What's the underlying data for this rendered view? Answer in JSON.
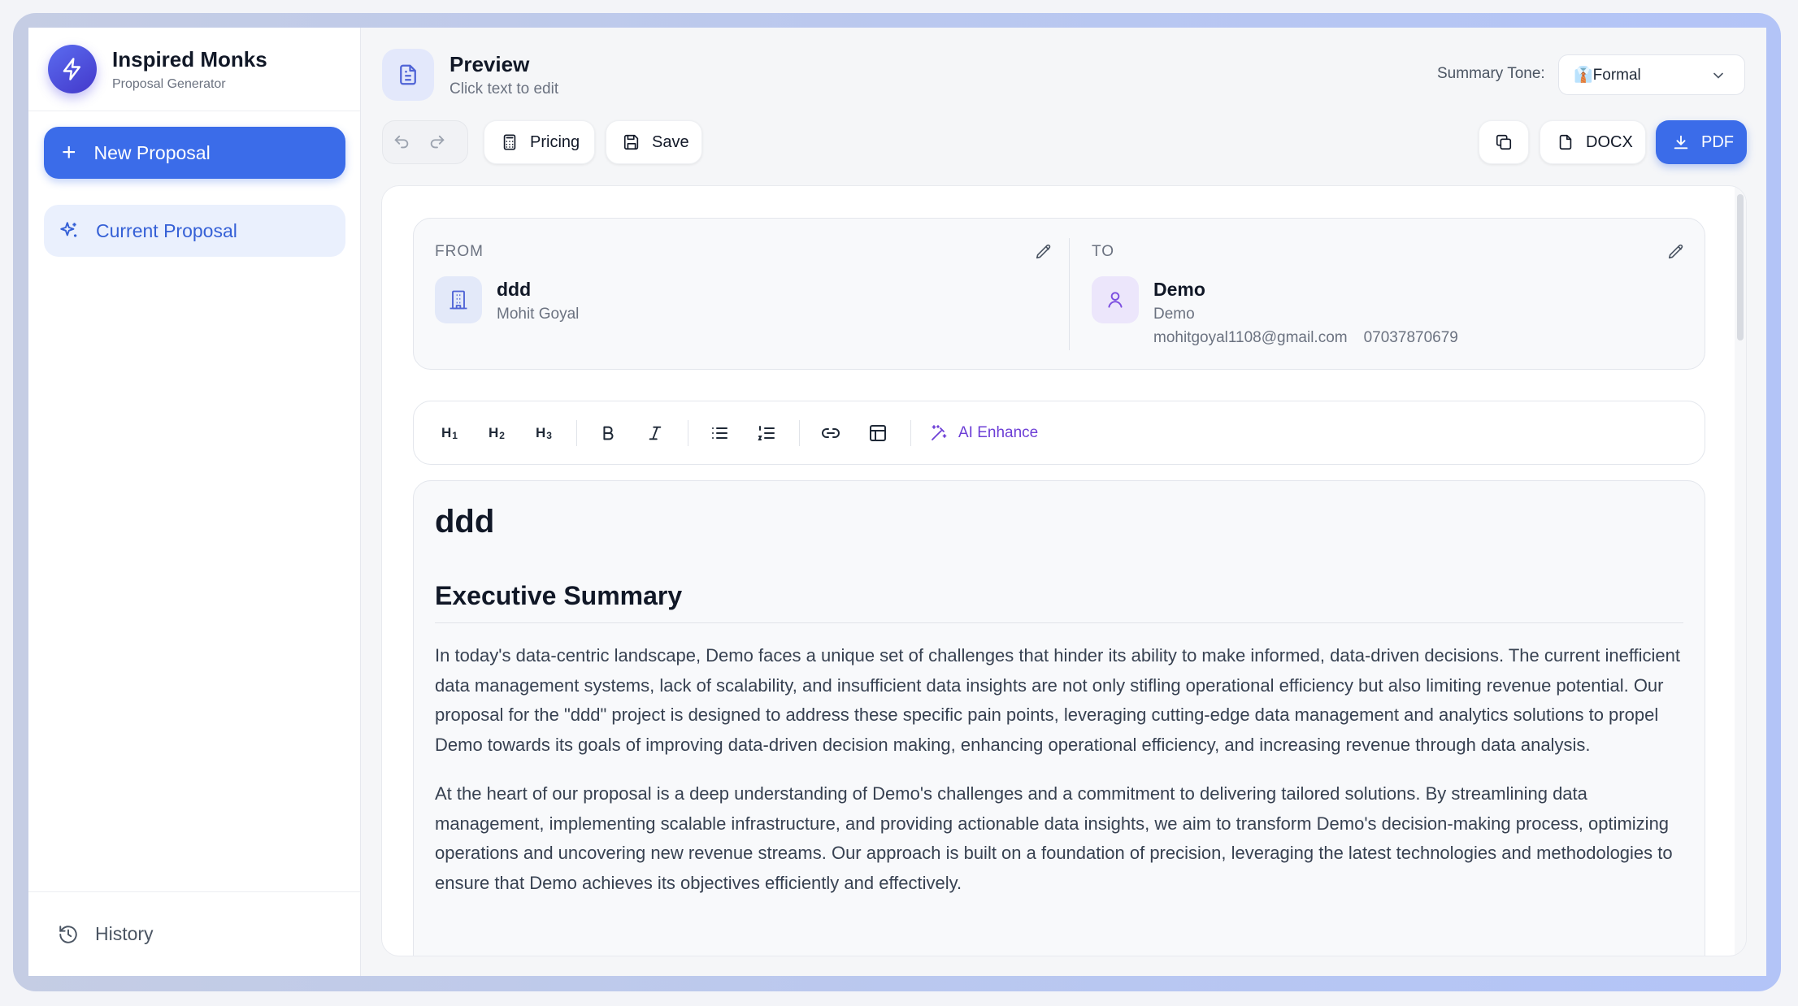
{
  "sidebar": {
    "brand_title": "Inspired Monks",
    "brand_subtitle": "Proposal Generator",
    "new_proposal": "New Proposal",
    "current_proposal": "Current Proposal",
    "history": "History"
  },
  "header": {
    "title": "Preview",
    "subtitle": "Click text to edit",
    "tone_label": "Summary Tone:",
    "tone_value": "👔Formal"
  },
  "toolbar": {
    "pricing": "Pricing",
    "save": "Save",
    "docx": "DOCX",
    "pdf": "PDF"
  },
  "from": {
    "label": "FROM",
    "name": "ddd",
    "person": "Mohit Goyal"
  },
  "to": {
    "label": "TO",
    "name": "Demo",
    "company": "Demo",
    "email": "mohitgoyal1108@gmail.com",
    "phone": "07037870679"
  },
  "editor": {
    "h1": "H",
    "h1_sub": "1",
    "h2": "H",
    "h2_sub": "2",
    "h3": "H",
    "h3_sub": "3",
    "ai_enhance": "AI Enhance"
  },
  "document": {
    "title": "ddd",
    "section_heading": "Executive Summary",
    "paragraphs": [
      "In today's data-centric landscape, Demo faces a unique set of challenges that hinder its ability to make informed, data-driven decisions. The current inefficient data management systems, lack of scalability, and insufficient data insights are not only stifling operational efficiency but also limiting revenue potential. Our proposal for the \"ddd\" project is designed to address these specific pain points, leveraging cutting-edge data management and analytics solutions to propel Demo towards its goals of improving data-driven decision making, enhancing operational efficiency, and increasing revenue through data analysis.",
      "At the heart of our proposal is a deep understanding of Demo's challenges and a commitment to delivering tailored solutions. By streamlining data management, implementing scalable infrastructure, and providing actionable data insights, we aim to transform Demo's decision-making process, optimizing operations and uncovering new revenue streams. Our approach is built on a foundation of precision, leveraging the latest technologies and methodologies to ensure that Demo achieves its objectives efficiently and effectively."
    ]
  },
  "colors": {
    "accent": "#3b6ce9",
    "ai_purple": "#6d3fd6"
  }
}
